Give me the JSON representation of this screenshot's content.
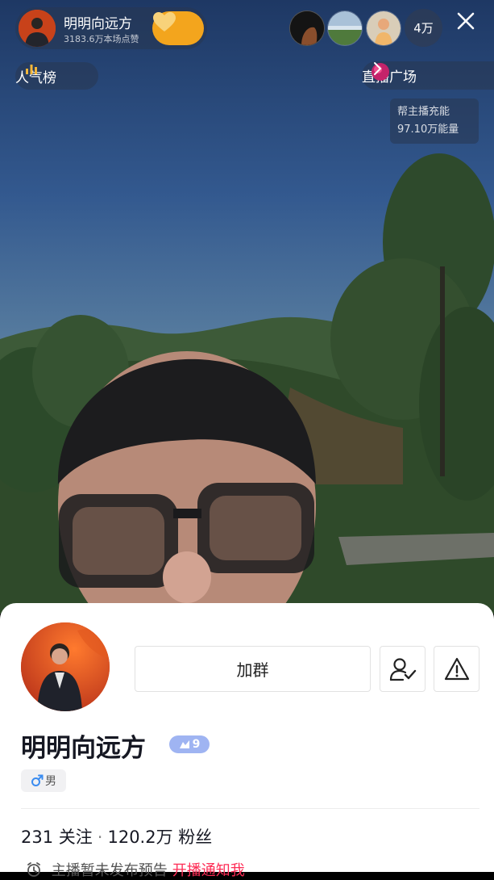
{
  "host": {
    "name": "明明向远方",
    "likes": "3183.6万本场点赞"
  },
  "top_right": {
    "viewer_count": "4万"
  },
  "rank": {
    "label": "人气榜"
  },
  "square": {
    "label": "直播广场"
  },
  "energy": {
    "line1": "帮主播充能",
    "line2": "97.10万能量"
  },
  "profile": {
    "name": "明明向远方",
    "level": "9",
    "gender": "男",
    "join_label": "加群",
    "following_count": "231",
    "following_label": "关注",
    "separator": "·",
    "fans_count": "120.2万",
    "fans_label": "粉丝",
    "notice": "主播暂未发布预告",
    "notice_link": "开播通知我"
  },
  "colors": {
    "accent": "#fe2c55",
    "heart_button": "#f3a51d",
    "level_badge": "#9fb4f2"
  }
}
